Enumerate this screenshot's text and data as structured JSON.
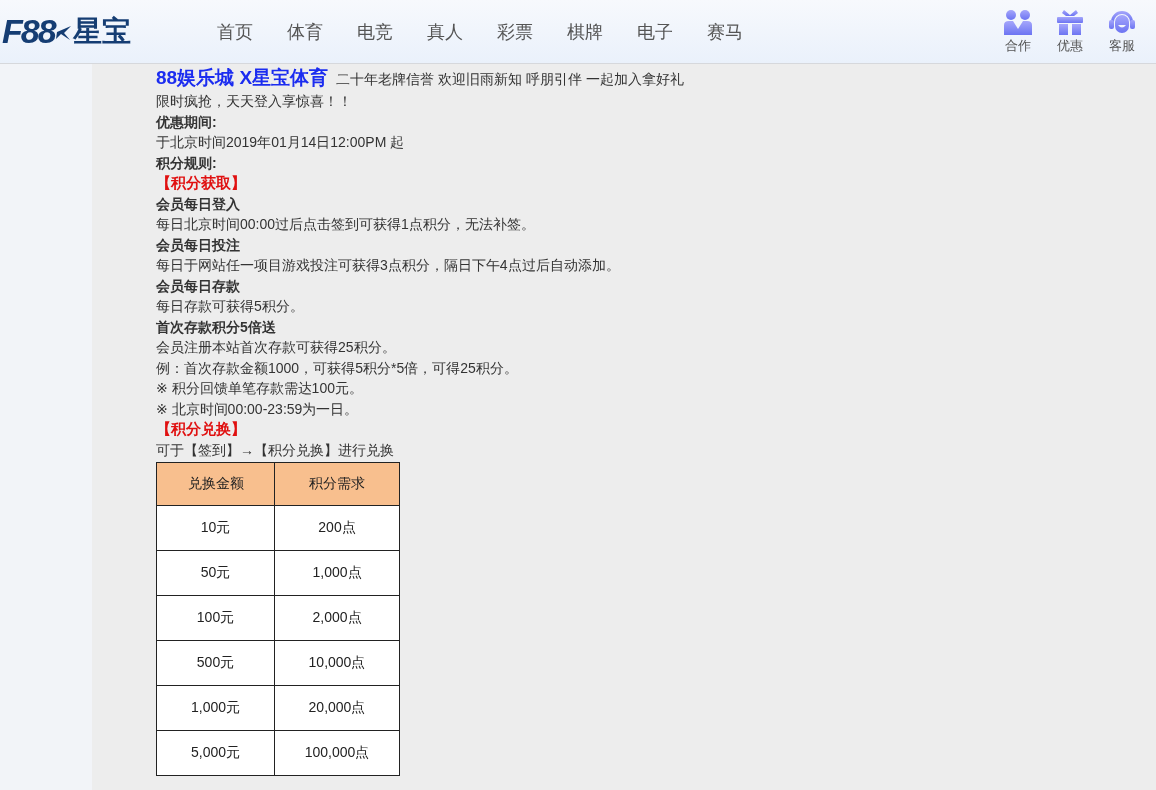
{
  "header": {
    "logo": {
      "brand": "F88",
      "name": "星宝"
    },
    "nav": [
      {
        "label": "首页"
      },
      {
        "label": "体育"
      },
      {
        "label": "电竞"
      },
      {
        "label": "真人"
      },
      {
        "label": "彩票"
      },
      {
        "label": "棋牌"
      },
      {
        "label": "电子"
      },
      {
        "label": "赛马"
      }
    ],
    "actions": [
      {
        "kind": "partner",
        "label": "合作"
      },
      {
        "kind": "promo",
        "label": "优惠"
      },
      {
        "kind": "support",
        "label": "客服"
      }
    ]
  },
  "content": {
    "intro": {
      "title": "88娱乐城 X星宝体育",
      "text": "二十年老牌信誉  欢迎旧雨新知 呼朋引伴 一起加入拿好礼"
    },
    "lines": [
      {
        "kind": "text",
        "text": "限时疯抢，天天登入享惊喜！！"
      },
      {
        "kind": "heading",
        "text": "优惠期间:"
      },
      {
        "kind": "text",
        "text": "于北京时间2019年01月14日12:00PM 起"
      },
      {
        "kind": "heading",
        "text": "积分规则:"
      },
      {
        "kind": "section",
        "text": "【积分获取】"
      },
      {
        "kind": "heading",
        "text": "会员每日登入"
      },
      {
        "kind": "text",
        "text": "每日北京时间00:00过后点击签到可获得1点积分，无法补签。"
      },
      {
        "kind": "heading",
        "text": "会员每日投注"
      },
      {
        "kind": "text",
        "text": "每日于网站任一项目游戏投注可获得3点积分，隔日下午4点过后自动添加。"
      },
      {
        "kind": "heading",
        "text": "会员每日存款"
      },
      {
        "kind": "text",
        "text": "每日存款可获得5积分。"
      },
      {
        "kind": "heading",
        "text": "首次存款积分5倍送"
      },
      {
        "kind": "text",
        "text": "会员注册本站首次存款可获得25积分。"
      },
      {
        "kind": "text",
        "text": "例：首次存款金额1000，可获得5积分*5倍，可得25积分。"
      },
      {
        "kind": "text",
        "text": "※ 积分回馈单笔存款需达100元。"
      },
      {
        "kind": "text",
        "text": "※ 北京时间00:00-23:59为一日。"
      },
      {
        "kind": "section",
        "text": "【积分兑换】"
      },
      {
        "kind": "text",
        "text": "可于【签到】→【积分兑换】进行兑换"
      }
    ],
    "table": {
      "columns": [
        "兑换金额",
        "积分需求"
      ],
      "rows": [
        [
          "10元",
          "200点"
        ],
        [
          "50元",
          "1,000点"
        ],
        [
          "100元",
          "2,000点"
        ],
        [
          "500元",
          "10,000点"
        ],
        [
          "1,000元",
          "20,000点"
        ],
        [
          "5,000元",
          "100,000点"
        ]
      ]
    }
  }
}
